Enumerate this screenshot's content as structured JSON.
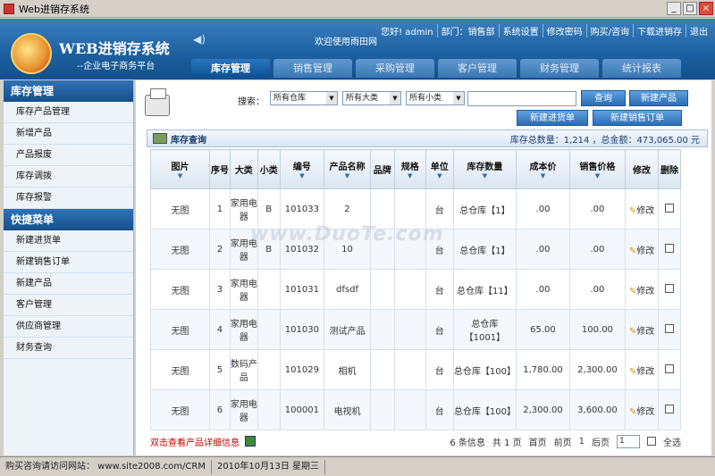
{
  "window": {
    "title": "Web进销存系统"
  },
  "header": {
    "logo_title": "WEB进销存系统",
    "logo_subtitle": "--企业电子商务平台",
    "welcome": "欢迎使用雨田网",
    "user_links": [
      "您好! admin",
      "部门：销售部",
      "系统设置",
      "修改密码",
      "购买/咨询",
      "下载进销存",
      "退出"
    ],
    "tabs": [
      "库存管理",
      "销售管理",
      "采购管理",
      "客户管理",
      "财务管理",
      "统计报表"
    ],
    "active_tab": 0
  },
  "sidebar": {
    "section1": "库存管理",
    "items1": [
      "库存产品管理",
      "新增产品",
      "产品报废",
      "库存调拨",
      "库存报警"
    ],
    "section2": "快捷菜单",
    "items2": [
      "新建进货单",
      "新建销售订单",
      "新建产品",
      "客户管理",
      "供应商管理",
      "财务查询"
    ]
  },
  "toolbar": {
    "search_label": "搜索：",
    "warehouse": "所有仓库",
    "category": "所有大类",
    "subcategory": "所有小类",
    "search_btn": "查询",
    "new_product_btn": "新建产品",
    "new_purchase_btn": "新建进货单",
    "new_sales_btn": "新建销售订单"
  },
  "panel": {
    "title": "库存查询",
    "totals": "库存总数量：1,214 ，总金额：473,065.00 元"
  },
  "table": {
    "headers": [
      "图片",
      "序号",
      "大类",
      "小类",
      "编号",
      "产品名称",
      "品牌",
      "规格",
      "单位",
      "库存数量",
      "成本价",
      "销售价格",
      "修改",
      "删除"
    ],
    "rows": [
      [
        "无图",
        "1",
        "家用电器",
        "B",
        "101033",
        "2",
        "",
        "",
        "台",
        "总仓库【1】",
        ".00",
        ".00",
        "修改"
      ],
      [
        "无图",
        "2",
        "家用电器",
        "B",
        "101032",
        "10",
        "",
        "",
        "台",
        "总仓库【1】",
        ".00",
        ".00",
        "修改"
      ],
      [
        "无图",
        "3",
        "家用电器",
        "",
        "101031",
        "dfsdf",
        "",
        "",
        "台",
        "总仓库【11】",
        ".00",
        ".00",
        "修改"
      ],
      [
        "无图",
        "4",
        "家用电器",
        "",
        "101030",
        "测试产品",
        "",
        "",
        "台",
        "总仓库【1001】",
        "65.00",
        "100.00",
        "修改"
      ],
      [
        "无图",
        "5",
        "数码产品",
        "",
        "101029",
        "相机",
        "",
        "",
        "台",
        "总仓库【100】",
        "1,780.00",
        "2,300.00",
        "修改"
      ],
      [
        "无图",
        "6",
        "家用电器",
        "",
        "100001",
        "电视机",
        "",
        "",
        "台",
        "总仓库【100】",
        "2,300.00",
        "3,600.00",
        "修改"
      ]
    ]
  },
  "footer": {
    "detail_hint": "双击查看产品详细信息",
    "info": "6 条信息",
    "pages": "共 1 页",
    "first": "首页",
    "prev": "前页",
    "current": "1",
    "last": "后页",
    "page_select": "1",
    "select_all": "全选"
  },
  "statusbar": {
    "link": "购买咨询请访问网站： www.site2008.com/CRM",
    "date": "2010年10月13日 星期三"
  },
  "watermark": "www.DuoTe.com"
}
